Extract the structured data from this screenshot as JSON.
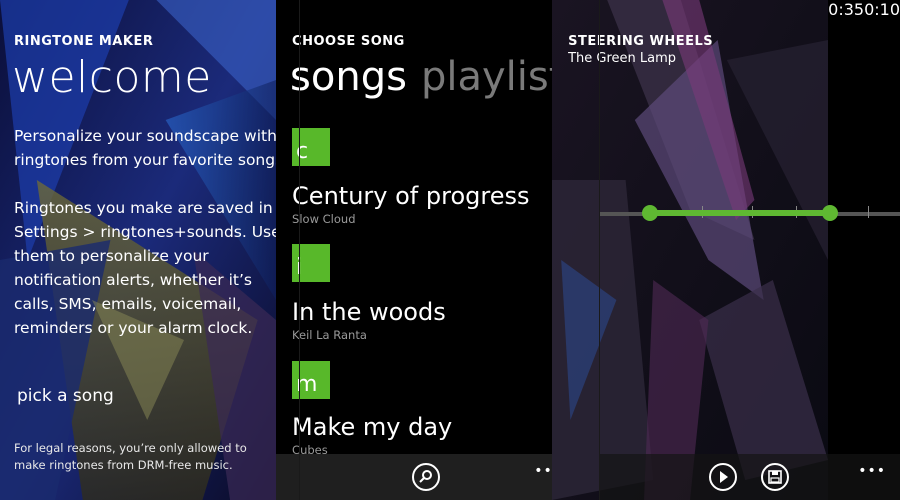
{
  "screen1": {
    "app_title": "RINGTONE MAKER",
    "page_title": "welcome",
    "paragraph1": "Personalize your soundscape with ringtones from your favorite songs.",
    "paragraph2": "Ringtones you make are saved in Settings > ringtones+sounds. Use them to personalize your notification alerts, whether it’s calls, SMS, emails, voicemail, reminders or your alarm clock.",
    "pick_song": "pick a song",
    "legal": "For legal reasons, you’re only allowed to make ringtones from DRM-free music."
  },
  "screen2": {
    "app_title": "CHOOSE SONG",
    "pivots": [
      "songs",
      "playlists"
    ],
    "groups": [
      {
        "letter": "c",
        "title": "Century of progress",
        "artist": "Slow Cloud"
      },
      {
        "letter": "i",
        "title": "In the woods",
        "artist": "Keil La Ranta"
      },
      {
        "letter": "m",
        "title": "Make my day",
        "artist": "Cubes"
      }
    ],
    "appbar": {
      "search_icon": "search-icon",
      "more": "•••"
    }
  },
  "screen3": {
    "song_title": "STEERING WHEELS",
    "artist": "The Green Lamp",
    "start_time": "0:10",
    "end_time": "0:35",
    "appbar": {
      "play_icon": "play-icon",
      "save_icon": "save-icon",
      "more": "•••"
    }
  },
  "colors": {
    "accent": "#58b82a",
    "background": "#000000"
  }
}
